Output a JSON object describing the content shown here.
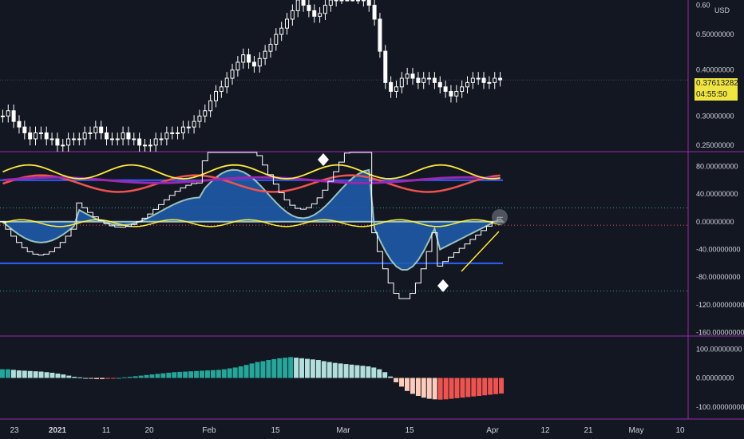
{
  "currency": "USD",
  "current_price": "0.37613282",
  "countdown": "04:55:50",
  "colors": {
    "background": "#131722",
    "pane_border": "#9c27b0",
    "up_candle": "#ffffff",
    "down_candle": "#ffffff",
    "price_tag": "#f0e442",
    "accent_yellow": "#ffeb3b",
    "histogram_teal": "#26a69a",
    "histogram_light_teal": "#b2dfdb",
    "histogram_salmon": "#ffccbc",
    "histogram_red": "#ef5350",
    "area_blue": "#1e5eb0",
    "line_red": "#ef5350",
    "line_purple": "#9c27b0"
  },
  "price_axis": {
    "labels": [
      "0.60",
      "0.50000000",
      "0.40000000",
      "0.30000000",
      "0.25000000"
    ]
  },
  "oscillator_axis": {
    "labels": [
      "80.00000000",
      "40.00000000",
      "0.00000000",
      "-40.00000000",
      "-80.00000000",
      "-120.00000000",
      "-160.00000000"
    ]
  },
  "histogram_axis": {
    "labels": [
      "100.00000000",
      "0.00000000",
      "-100.00000000"
    ]
  },
  "time_axis": {
    "labels": [
      "23",
      "2021",
      "11",
      "20",
      "Feb",
      "15",
      "Mar",
      "15",
      "Apr",
      "12",
      "21",
      "May",
      "10"
    ]
  },
  "chart_data": {
    "type": "candlestick",
    "price_scale": "log",
    "price_range": [
      0.24,
      0.62
    ],
    "oscillator_range": [
      -165,
      100
    ],
    "histogram_range": [
      -120,
      120
    ],
    "close_prices": [
      0.3,
      0.31,
      0.29,
      0.28,
      0.27,
      0.26,
      0.27,
      0.27,
      0.26,
      0.26,
      0.25,
      0.25,
      0.26,
      0.26,
      0.26,
      0.27,
      0.27,
      0.28,
      0.27,
      0.26,
      0.26,
      0.26,
      0.27,
      0.26,
      0.26,
      0.25,
      0.25,
      0.25,
      0.26,
      0.26,
      0.27,
      0.27,
      0.27,
      0.28,
      0.28,
      0.29,
      0.3,
      0.31,
      0.33,
      0.35,
      0.36,
      0.38,
      0.4,
      0.42,
      0.44,
      0.42,
      0.41,
      0.43,
      0.45,
      0.47,
      0.5,
      0.52,
      0.55,
      0.58,
      0.62,
      0.6,
      0.58,
      0.56,
      0.57,
      0.6,
      0.62,
      0.63,
      0.64,
      0.65,
      0.64,
      0.63,
      0.62,
      0.6,
      0.55,
      0.45,
      0.37,
      0.35,
      0.36,
      0.38,
      0.39,
      0.38,
      0.37,
      0.38,
      0.38,
      0.37,
      0.36,
      0.35,
      0.34,
      0.35,
      0.36,
      0.37,
      0.38,
      0.38,
      0.37,
      0.37,
      0.38,
      0.376
    ],
    "histogram_values": [
      30,
      30,
      28,
      26,
      25,
      24,
      23,
      22,
      20,
      18,
      15,
      12,
      8,
      4,
      2,
      0,
      -2,
      -4,
      -4,
      -3,
      -2,
      0,
      2,
      4,
      6,
      8,
      10,
      12,
      14,
      16,
      18,
      20,
      21,
      22,
      23,
      24,
      25,
      26,
      27,
      28,
      30,
      33,
      36,
      40,
      45,
      50,
      55,
      58,
      62,
      65,
      68,
      70,
      72,
      70,
      68,
      66,
      64,
      62,
      58,
      55,
      52,
      50,
      48,
      46,
      44,
      42,
      40,
      36,
      30,
      20,
      5,
      -15,
      -30,
      -45,
      -55,
      -62,
      -68,
      -72,
      -74,
      -75,
      -74,
      -72,
      -70,
      -68,
      -66,
      -64,
      -62,
      -60,
      -58,
      -56,
      -54
    ]
  }
}
